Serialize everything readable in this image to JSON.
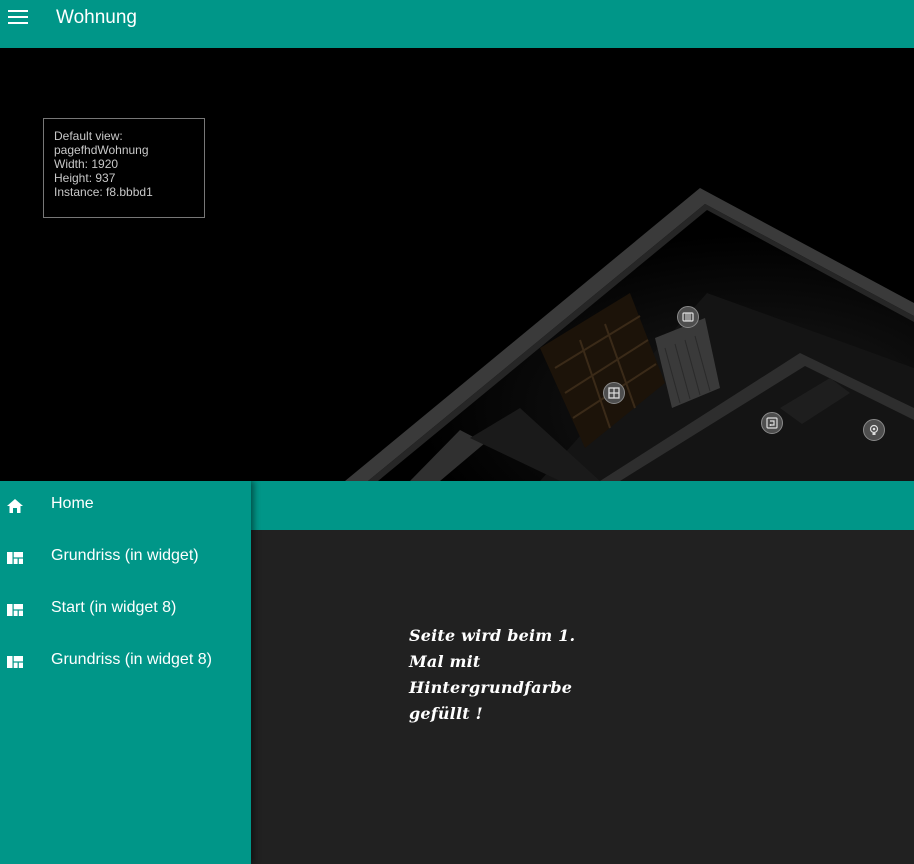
{
  "header": {
    "title": "Wohnung",
    "menu_icon": "hamburger-menu-icon"
  },
  "view_info": {
    "line1": "Default view:",
    "line2": "pagefhdWohnung",
    "line3": "Width: 1920",
    "line4": "Height: 937",
    "line5": "Instance: f8.bbbd1"
  },
  "floorplan_devices": [
    {
      "icon": "radiator-icon"
    },
    {
      "icon": "window-icon"
    },
    {
      "icon": "door-sensor-icon"
    },
    {
      "icon": "lightbulb-icon"
    }
  ],
  "drawer": {
    "items": [
      {
        "label": "Home",
        "icon": "home-icon"
      },
      {
        "label": "Grundriss (in widget)",
        "icon": "view-quilt-icon"
      },
      {
        "label": "Start (in widget 8)",
        "icon": "view-quilt-icon"
      },
      {
        "label": "Grundriss (in widget 8)",
        "icon": "view-quilt-icon"
      }
    ]
  },
  "content": {
    "line1": "Seite wird beim 1.",
    "line2": "Mal mit",
    "line3": "Hintergrundfarbe",
    "line4": "gefüllt !"
  },
  "colors": {
    "primary": "#009688",
    "content_background": "#212121",
    "scene_background": "#000000"
  }
}
